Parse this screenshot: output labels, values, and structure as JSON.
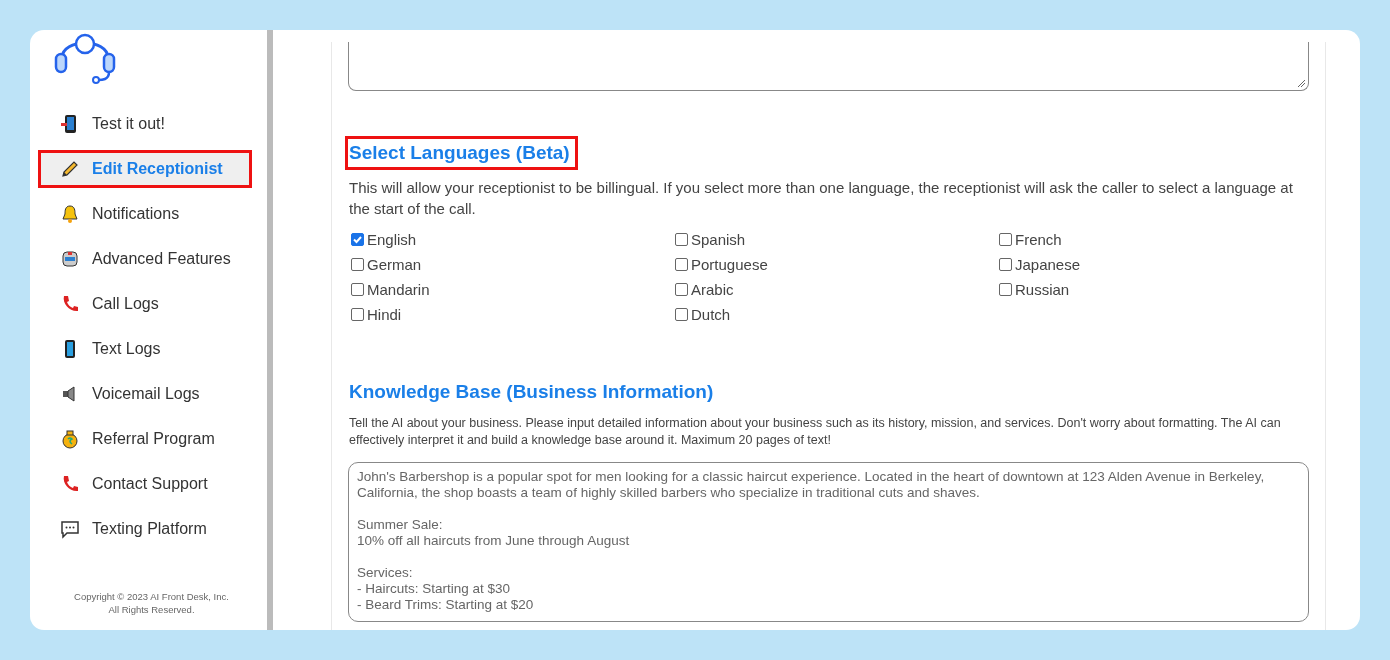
{
  "sidebar": {
    "items": [
      {
        "label": "Test it out!",
        "selected": false,
        "highlighted": false
      },
      {
        "label": "Edit Receptionist",
        "selected": true,
        "highlighted": true
      },
      {
        "label": "Notifications",
        "selected": false,
        "highlighted": false
      },
      {
        "label": "Advanced Features",
        "selected": false,
        "highlighted": false
      },
      {
        "label": "Call Logs",
        "selected": false,
        "highlighted": false
      },
      {
        "label": "Text Logs",
        "selected": false,
        "highlighted": false
      },
      {
        "label": "Voicemail Logs",
        "selected": false,
        "highlighted": false
      },
      {
        "label": "Referral Program",
        "selected": false,
        "highlighted": false
      },
      {
        "label": "Contact Support",
        "selected": false,
        "highlighted": false
      },
      {
        "label": "Texting Platform",
        "selected": false,
        "highlighted": false
      }
    ],
    "copyright": [
      "Copyright © 2023 AI Front Desk, Inc.",
      "All Rights Reserved."
    ]
  },
  "languages": {
    "title": "Select Languages (Beta)",
    "highlighted": true,
    "description": "This will allow your receptionist to be billingual. If you select more than one language, the receptionist will ask the caller to select a language at the start of the call.",
    "options": [
      {
        "label": "English",
        "checked": true
      },
      {
        "label": "Spanish",
        "checked": false
      },
      {
        "label": "French",
        "checked": false
      },
      {
        "label": "German",
        "checked": false
      },
      {
        "label": "Portuguese",
        "checked": false
      },
      {
        "label": "Japanese",
        "checked": false
      },
      {
        "label": "Mandarin",
        "checked": false
      },
      {
        "label": "Arabic",
        "checked": false
      },
      {
        "label": "Russian",
        "checked": false
      },
      {
        "label": "Hindi",
        "checked": false
      },
      {
        "label": "Dutch",
        "checked": false
      }
    ]
  },
  "knowledge_base": {
    "title": "Knowledge Base (Business Information)",
    "description": "Tell the AI about your business. Please input detailed information about your business such as its history, mission, and services. Don't worry about formatting. The AI can effectively interpret it and build a knowledge base around it. Maximum 20 pages of text!",
    "value": "John's Barbershop is a popular spot for men looking for a classic haircut experience. Located in the heart of downtown at 123 Alden Avenue in Berkeley, California, the shop boasts a team of highly skilled barbers who specialize in traditional cuts and shaves.\n\nSummer Sale:\n10% off all haircuts from June through August\n\nServices:\n- Haircuts: Starting at $30\n- Beard Trims: Starting at $20"
  }
}
